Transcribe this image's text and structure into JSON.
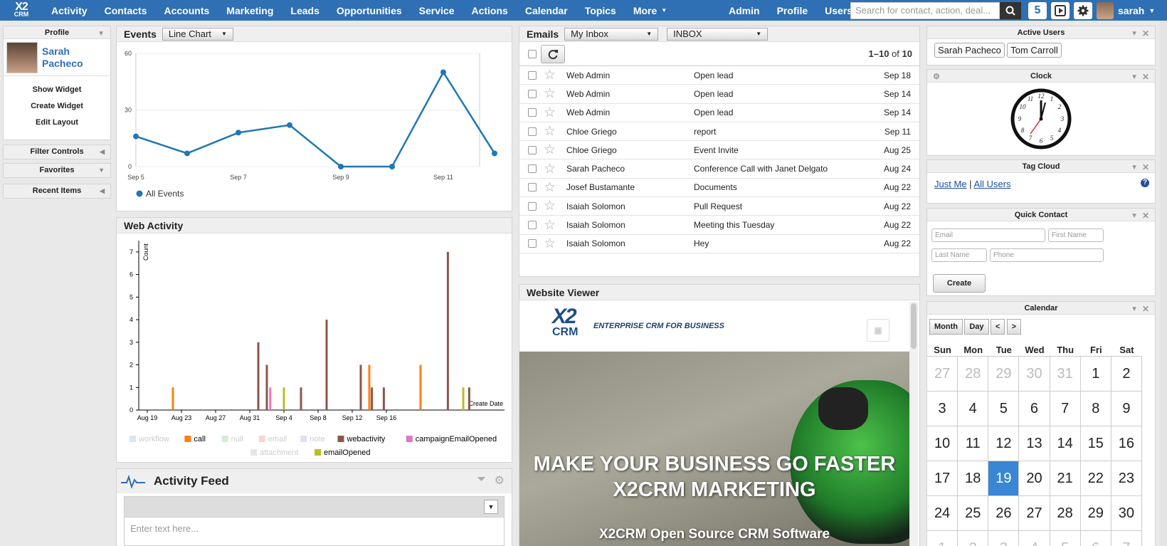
{
  "nav": {
    "logo_line1": "X2",
    "logo_line2": "CRM",
    "items": [
      "Activity",
      "Contacts",
      "Accounts",
      "Marketing",
      "Leads",
      "Opportunities",
      "Service",
      "Actions",
      "Calendar",
      "Topics",
      "More"
    ],
    "right_items": [
      "Admin",
      "Profile",
      "Users"
    ],
    "search_placeholder": "Search for contact, action, deal...",
    "notification_count": "5",
    "username": "sarah"
  },
  "profile": {
    "title": "Profile",
    "name": "Sarah Pacheco",
    "links": [
      "Show Widget",
      "Create Widget",
      "Edit Layout"
    ]
  },
  "sidebar_sections": [
    "Filter Controls",
    "Favorites",
    "Recent Items"
  ],
  "events": {
    "title": "Events",
    "chart_type_label": "Line Chart",
    "legend": "All Events"
  },
  "chart_data": [
    {
      "type": "line",
      "x": [
        "Sep 5",
        "Sep 6",
        "Sep 7",
        "Sep 8",
        "Sep 9",
        "Sep 10",
        "Sep 11",
        "Sep 12"
      ],
      "tick_labels": [
        "Sep 5",
        "Sep 7",
        "Sep 9",
        "Sep 11"
      ],
      "series": [
        {
          "name": "All Events",
          "values": [
            16,
            7,
            18,
            22,
            0,
            0,
            50,
            7
          ]
        }
      ],
      "ylim": [
        0,
        60
      ],
      "yticks": [
        0,
        30,
        60
      ],
      "color": "#1f77b4"
    },
    {
      "type": "bar",
      "title": "Web Activity",
      "xlabel": "Create Date",
      "ylabel": "Count",
      "ylim": [
        0,
        7.5
      ],
      "yticks": [
        0,
        1,
        2,
        3,
        4,
        5,
        6,
        7
      ],
      "x_tick_labels": [
        "Aug 19",
        "Aug 23",
        "Aug 27",
        "Aug 31",
        "Sep 4",
        "Sep 8",
        "Sep 12",
        "Sep 16"
      ],
      "x_start_day": 18,
      "x_end_day": 48,
      "bars": [
        {
          "day": 22,
          "series": "call",
          "value": 1
        },
        {
          "day": 32,
          "series": "webactivity",
          "value": 3
        },
        {
          "day": 33,
          "series": "webactivity",
          "value": 2
        },
        {
          "day": 33.4,
          "series": "campaignEmailOpened",
          "value": 1
        },
        {
          "day": 35,
          "series": "emailOpened",
          "value": 1
        },
        {
          "day": 37,
          "series": "webactivity",
          "value": 1
        },
        {
          "day": 40,
          "series": "webactivity",
          "value": 4
        },
        {
          "day": 44,
          "series": "webactivity",
          "value": 2
        },
        {
          "day": 45,
          "series": "call",
          "value": 2
        },
        {
          "day": 45.3,
          "series": "webactivity",
          "value": 1
        },
        {
          "day": 46.7,
          "series": "webactivity",
          "value": 1
        },
        {
          "day": 51,
          "series": "call",
          "value": 2
        },
        {
          "day": 54.2,
          "series": "webactivity",
          "value": 7
        },
        {
          "day": 56,
          "series": "emailOpened",
          "value": 1
        },
        {
          "day": 56.7,
          "series": "webactivity",
          "value": 1
        }
      ],
      "legend": [
        {
          "name": "workflow",
          "color": "#d6e7f5",
          "active": false
        },
        {
          "name": "call",
          "color": "#ff7f0e",
          "active": true
        },
        {
          "name": "null",
          "color": "#d5ecd4",
          "active": false
        },
        {
          "name": "email",
          "color": "#f7d6d2",
          "active": false
        },
        {
          "name": "note",
          "color": "#e5dcef",
          "active": false
        },
        {
          "name": "webactivity",
          "color": "#8c564b",
          "active": true
        },
        {
          "name": "campaignEmailOpened",
          "color": "#e377c2",
          "active": true
        },
        {
          "name": "attachment",
          "color": "#e6e6e6",
          "active": false
        },
        {
          "name": "emailOpened",
          "color": "#bcbd22",
          "active": true
        }
      ]
    }
  ],
  "activity_feed": {
    "title": "Activity Feed",
    "placeholder": "Enter text here..."
  },
  "emails": {
    "title": "Emails",
    "inbox_select": "My Inbox",
    "folder_select": "INBOX",
    "pagination_range": "1–10",
    "pagination_of": "of",
    "pagination_total": "10",
    "rows": [
      {
        "from": "Web Admin",
        "subject": "Open lead",
        "date": "Sep 18"
      },
      {
        "from": "Web Admin",
        "subject": "Open lead",
        "date": "Sep 14"
      },
      {
        "from": "Web Admin",
        "subject": "Open lead",
        "date": "Sep 14"
      },
      {
        "from": "Chloe Griego",
        "subject": "report",
        "date": "Sep 11"
      },
      {
        "from": "Chloe Griego",
        "subject": "Event Invite",
        "date": "Aug 25"
      },
      {
        "from": "Sarah Pacheco",
        "subject": "Conference Call with Janet Delgato",
        "date": "Aug 24"
      },
      {
        "from": "Josef Bustamante",
        "subject": "Documents",
        "date": "Aug 22"
      },
      {
        "from": "Isaiah Solomon",
        "subject": "Pull Request",
        "date": "Aug 22"
      },
      {
        "from": "Isaiah Solomon",
        "subject": "Meeting this Tuesday",
        "date": "Aug 22"
      },
      {
        "from": "Isaiah Solomon",
        "subject": "Hey",
        "date": "Aug 22"
      }
    ]
  },
  "website_viewer": {
    "title": "Website Viewer",
    "logo_text": "X2",
    "logo_sub": "CRM",
    "tagline": "ENTERPRISE CRM FOR BUSINESS",
    "hero_line1": "MAKE YOUR BUSINESS GO FASTER",
    "hero_line2": "X2CRM MARKETING",
    "hero_sub": "X2CRM Open Source CRM Software"
  },
  "active_users": {
    "title": "Active Users",
    "users": [
      "Sarah Pacheco",
      "Tom Carroll"
    ]
  },
  "clock": {
    "title": "Clock"
  },
  "tag_cloud": {
    "title": "Tag Cloud",
    "link1": "Just Me",
    "separator": "|",
    "link2": "All Users",
    "help": "?"
  },
  "quick_contact": {
    "title": "Quick Contact",
    "email": "Email",
    "first_name": "First Name",
    "last_name": "Last Name",
    "phone": "Phone",
    "create": "Create"
  },
  "calendar": {
    "title": "Calendar",
    "buttons": [
      "Month",
      "Day",
      "<",
      ">"
    ],
    "day_headers": [
      "Sun",
      "Mon",
      "Tue",
      "Wed",
      "Thu",
      "Fri",
      "Sat"
    ],
    "days": [
      27,
      28,
      29,
      30,
      31,
      1,
      2,
      3,
      4,
      5,
      6,
      7,
      8,
      9,
      10,
      11,
      12,
      13,
      14,
      15,
      16,
      17,
      18,
      19,
      20,
      21,
      22,
      23,
      24,
      25,
      26,
      27,
      28,
      29,
      30,
      1,
      2,
      3,
      4,
      5,
      6,
      7
    ],
    "other_month_indices": [
      0,
      1,
      2,
      3,
      4,
      35,
      36,
      37,
      38,
      39,
      40,
      41
    ],
    "today_index": 23
  },
  "colors": {
    "nav": "#2f6fb3",
    "line": "#1f77b4",
    "today": "#3a86d4"
  }
}
